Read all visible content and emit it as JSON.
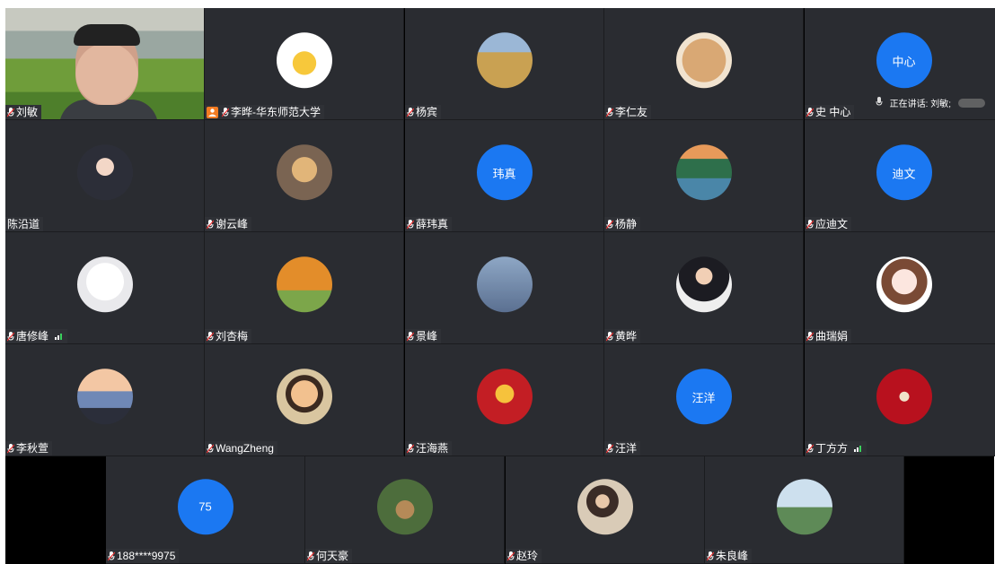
{
  "meeting": {
    "speaking_label": "正在讲话: 刘敏;",
    "participants": [
      {
        "name": "刘敏",
        "avatar": "video-feed"
      },
      {
        "name": "李晔-华东师范大学",
        "avatar": "cartoon-bear",
        "host": true
      },
      {
        "name": "杨宾",
        "avatar": "field-photo"
      },
      {
        "name": "李仁友",
        "avatar": "shiba-dog"
      },
      {
        "name": "史 中心",
        "avatar_text": "中心"
      },
      {
        "name": "陈沿道",
        "avatar": "anime-girl",
        "no_mic": true
      },
      {
        "name": "谢云峰",
        "avatar": "figurine"
      },
      {
        "name": "薛玮真",
        "avatar_text": "玮真"
      },
      {
        "name": "杨静",
        "avatar": "lake-scene"
      },
      {
        "name": "应迪文",
        "avatar_text": "迪文"
      },
      {
        "name": "唐修峰",
        "avatar": "cat-sunglasses",
        "signal": true
      },
      {
        "name": "刘杏梅",
        "avatar": "autumn-trees"
      },
      {
        "name": "景峰",
        "avatar": "silhouettes"
      },
      {
        "name": "黄晔",
        "avatar": "boy-suit"
      },
      {
        "name": "曲瑞娟",
        "avatar": "anime-masked-girl"
      },
      {
        "name": "李秋萱",
        "avatar": "sunset-man"
      },
      {
        "name": "WangZheng",
        "avatar": "smiling-boy"
      },
      {
        "name": "汪海燕",
        "avatar": "red-tiger"
      },
      {
        "name": "汪洋",
        "avatar_text": "汪洋"
      },
      {
        "name": "丁方方",
        "avatar": "red-emblem",
        "signal": true
      },
      {
        "name": "188****9975",
        "avatar_text": "75"
      },
      {
        "name": "何天豪",
        "avatar": "squirrel"
      },
      {
        "name": "赵玲",
        "avatar": "woman-reading"
      },
      {
        "name": "朱良峰",
        "avatar": "stadium-sky"
      }
    ]
  },
  "colors": {
    "tile": "#2a2c31",
    "avatar_blue": "#1b78f2",
    "host_badge": "#f57c22"
  }
}
